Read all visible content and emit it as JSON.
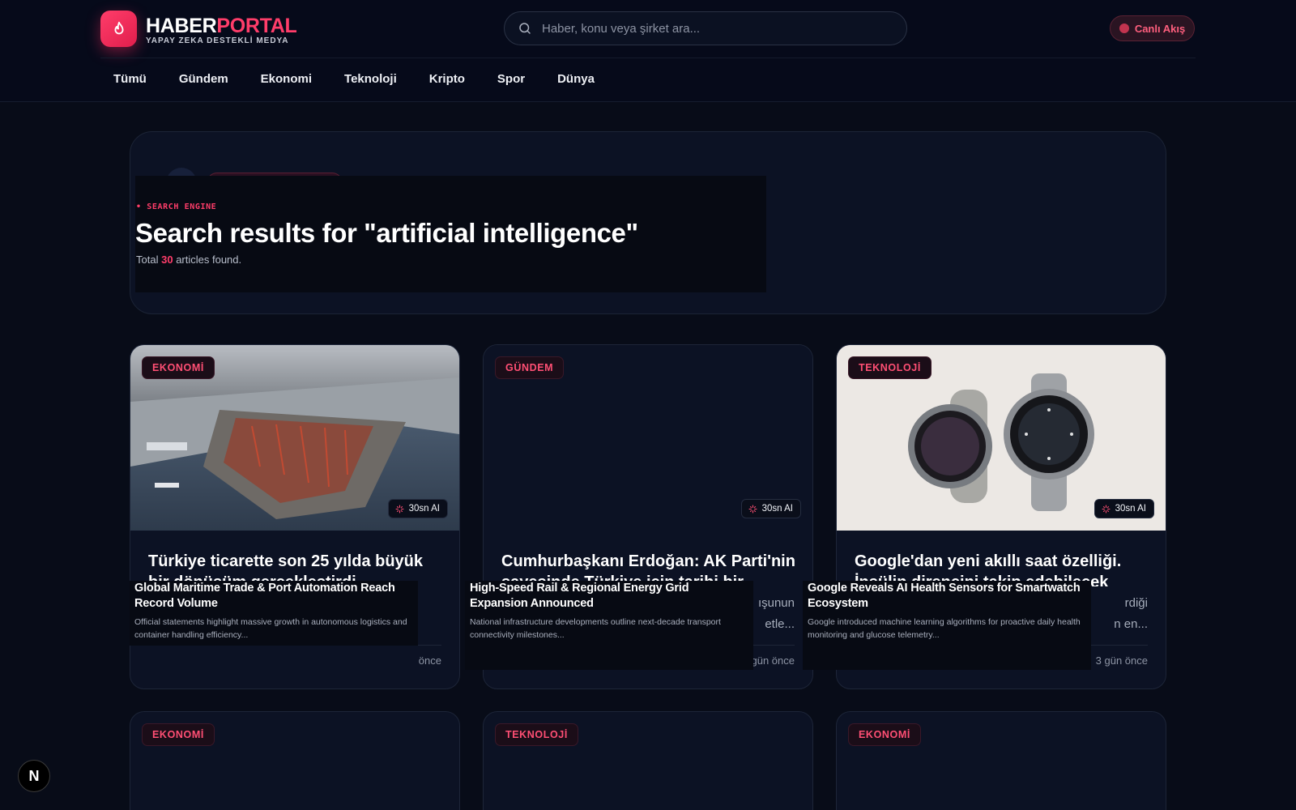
{
  "brand": {
    "name_a": "HABER",
    "name_b": "PORTAL",
    "tagline": "YAPAY ZEKA DESTEKLİ MEDYA"
  },
  "search": {
    "placeholder": "Haber, konu veya şirket ara..."
  },
  "live": {
    "label": "Canlı Akış"
  },
  "nav": [
    "Tümü",
    "Gündem",
    "Ekonomi",
    "Teknoloji",
    "Kripto",
    "Spor",
    "Dünya"
  ],
  "hero": {
    "eyebrow": "• SEARCH ENGINE",
    "title": "Search results for \"artificial intelligence\"",
    "count_prefix": "Total",
    "count": "30",
    "count_suffix": "articles found."
  },
  "cards": [
    {
      "tag": "EKONOMİ",
      "ai": "30sn AI",
      "title": "Türkiye ticarette son 25 yılda büyük bir dönüşüm gerçekleştirdi",
      "desc_tail": "",
      "time": "önce",
      "overlay_title": "Global Maritime Trade & Port Automation Reach Record Volume",
      "overlay_desc": "Official statements highlight massive growth in autonomous logistics and container handling efficiency..."
    },
    {
      "tag": "GÜNDEM",
      "ai": "30sn AI",
      "title": "Cumhurbaşkanı Erdoğan: AK Parti'nin sayesinde Türkiye için tarihi bir",
      "desc_tail": "ışunun\netle...",
      "time": "gün önce",
      "overlay_title": "High-Speed Rail & Regional Energy Grid Expansion Announced",
      "overlay_desc": "National infrastructure developments outline next-decade transport connectivity milestones..."
    },
    {
      "tag": "TEKNOLOJİ",
      "ai": "30sn AI",
      "title": "Google'dan yeni akıllı saat özelliği. İnsülin direncini takip edebilecek",
      "desc_tail": "rdiği\nn en...",
      "time": "3 gün önce",
      "overlay_title": "Google Reveals AI Health Sensors for Smartwatch Ecosystem",
      "overlay_desc": "Google introduced machine learning algorithms for proactive daily health monitoring and glucose telemetry..."
    }
  ],
  "cards_row2": [
    {
      "tag": "EKONOMİ"
    },
    {
      "tag": "TEKNOLOJİ"
    },
    {
      "tag": "EKONOMİ"
    }
  ],
  "fab": {
    "label": "N"
  }
}
